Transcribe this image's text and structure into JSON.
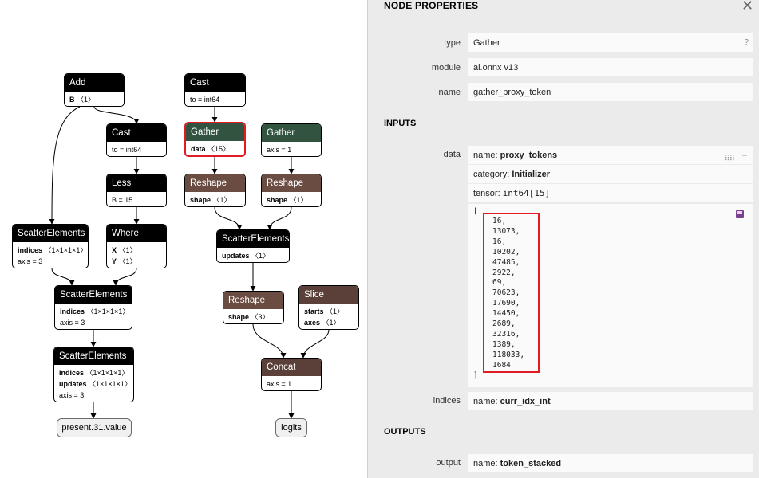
{
  "graph": {
    "nodes": {
      "add": {
        "title": "Add",
        "attrs": [
          {
            "k": "B",
            "v": "〈1〉"
          }
        ]
      },
      "cast1": {
        "title": "Cast",
        "attrs": [
          {
            "k": "",
            "v": "to = int64"
          }
        ]
      },
      "less": {
        "title": "Less",
        "attrs": [
          {
            "k": "",
            "v": "B = 15"
          }
        ]
      },
      "where": {
        "title": "Where",
        "attrs": [
          {
            "k": "X",
            "v": "〈1〉"
          },
          {
            "k": "Y",
            "v": "〈1〉"
          }
        ]
      },
      "scatter1": {
        "title": "ScatterElements",
        "attrs": [
          {
            "k": "indices",
            "v": "〈1×1×1×1〉"
          },
          {
            "k": "",
            "v": "axis = 3"
          }
        ]
      },
      "scatter2": {
        "title": "ScatterElements",
        "attrs": [
          {
            "k": "indices",
            "v": "〈1×1×1×1〉"
          },
          {
            "k": "",
            "v": "axis = 3"
          }
        ]
      },
      "scatter3": {
        "title": "ScatterElements",
        "attrs": [
          {
            "k": "indices",
            "v": "〈1×1×1×1〉"
          },
          {
            "k": "updates",
            "v": "〈1×1×1×1〉"
          },
          {
            "k": "",
            "v": "axis = 3"
          }
        ]
      },
      "cast2": {
        "title": "Cast",
        "attrs": [
          {
            "k": "",
            "v": "to = int64"
          }
        ]
      },
      "gather1": {
        "title": "Gather",
        "attrs": [
          {
            "k": "data",
            "v": "〈15〉"
          }
        ]
      },
      "gather2": {
        "title": "Gather",
        "attrs": [
          {
            "k": "",
            "v": "axis = 1"
          }
        ]
      },
      "reshape1": {
        "title": "Reshape",
        "attrs": [
          {
            "k": "shape",
            "v": "〈1〉"
          }
        ]
      },
      "reshape2": {
        "title": "Reshape",
        "attrs": [
          {
            "k": "shape",
            "v": "〈1〉"
          }
        ]
      },
      "scatter4": {
        "title": "ScatterElements",
        "attrs": [
          {
            "k": "updates",
            "v": "〈1〉"
          }
        ]
      },
      "reshape3": {
        "title": "Reshape",
        "attrs": [
          {
            "k": "shape",
            "v": "〈3〉"
          }
        ]
      },
      "slice": {
        "title": "Slice",
        "attrs": [
          {
            "k": "starts",
            "v": "〈1〉"
          },
          {
            "k": "axes",
            "v": "〈1〉"
          }
        ]
      },
      "concat": {
        "title": "Concat",
        "attrs": [
          {
            "k": "",
            "v": "axis = 1"
          }
        ]
      }
    },
    "outputs": {
      "present": "present.31.value",
      "logits": "logits"
    }
  },
  "panel": {
    "title": "NODE PROPERTIES",
    "close_glyph": "✕",
    "type_label": "type",
    "type_value": "Gather",
    "help_glyph": "?",
    "module_label": "module",
    "module_value": "ai.onnx v13",
    "name_label": "name",
    "name_value": "gather_proxy_token",
    "inputs_title": "INPUTS",
    "data_label": "data",
    "data_name_key": "name: ",
    "data_name": "proxy_tokens",
    "data_category_key": "category: ",
    "data_category": "Initializer",
    "data_tensor_key": "tensor: ",
    "data_tensor": "int64[15]",
    "tensor_open": "[",
    "tensor_close": "]",
    "tensor_values": [
      "16,",
      "13073,",
      "16,",
      "10202,",
      "47485,",
      "2922,",
      "69,",
      "70623,",
      "17690,",
      "14450,",
      "2689,",
      "32316,",
      "1389,",
      "118033,",
      "1684"
    ],
    "indices_label": "indices",
    "indices_name_key": "name: ",
    "indices_name": "curr_idx_int",
    "outputs_title": "OUTPUTS",
    "output_label": "output",
    "output_name_key": "name: ",
    "output_name": "token_stacked",
    "grip_icon": "drag-grip-icon",
    "save_icon": "save-icon"
  }
}
